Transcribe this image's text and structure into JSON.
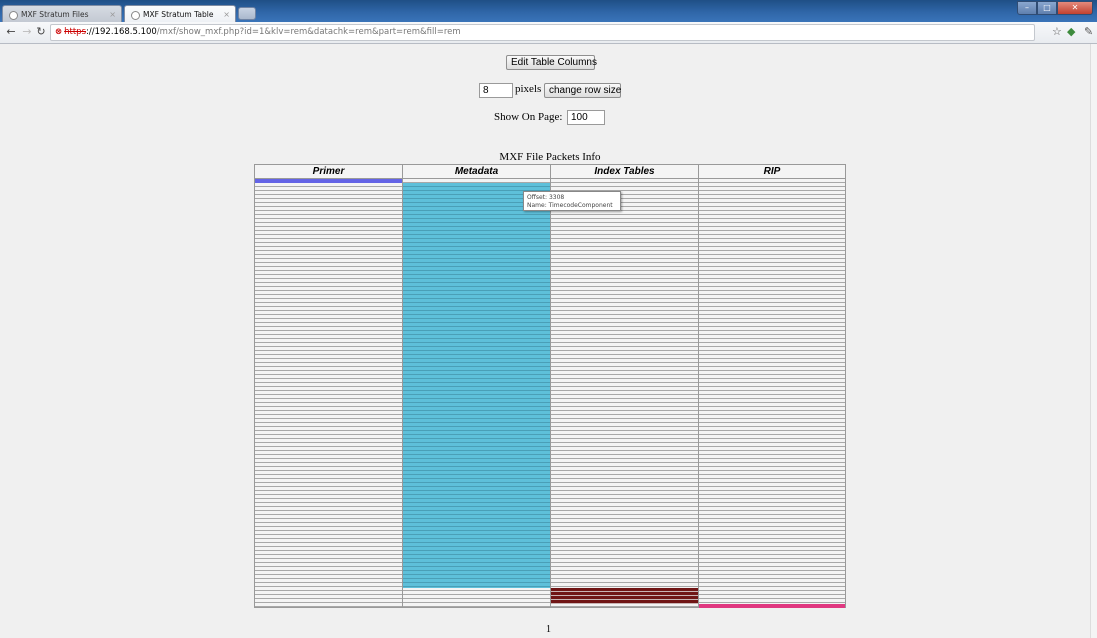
{
  "browser": {
    "tabs": [
      {
        "title": "MXF Stratum Files",
        "active": false
      },
      {
        "title": "MXF Stratum Table",
        "active": true
      }
    ],
    "url": {
      "scheme": "https",
      "host": "://192.168.5.100",
      "path": "/mxf/show_mxf.php?id=1&klv=rem&datachk=rem&part=rem&fill=rem"
    }
  },
  "controls": {
    "edit_columns_label": "Edit Table Columns",
    "row_size_value": "8",
    "pixels_label": "pixels",
    "change_row_size_label": "change row size",
    "show_on_page_label": "Show On Page:",
    "show_on_page_value": "100"
  },
  "table": {
    "caption": "MXF File Packets Info",
    "columns": [
      "Primer",
      "Metadata",
      "Index Tables",
      "RIP"
    ],
    "colors": {
      "primer": "#6464e6",
      "metadata": "#5ec0da",
      "index_tables": "#701515",
      "rip": "#e03880"
    }
  },
  "tooltip": {
    "offset": "Offset: 3308",
    "name": "Name: TimecodeComponent"
  },
  "pagination": {
    "page": "1"
  }
}
